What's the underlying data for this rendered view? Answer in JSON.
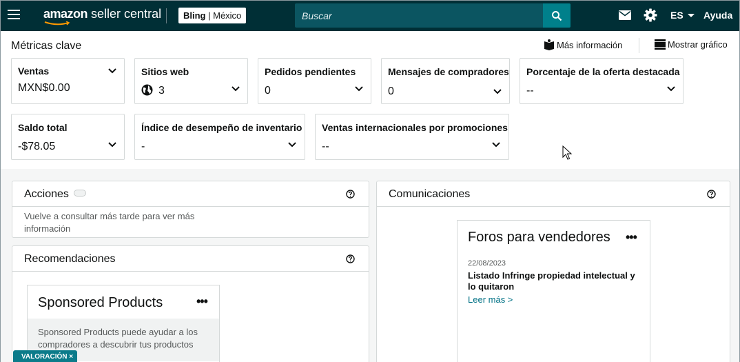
{
  "topnav": {
    "logo_brand": "amazon",
    "logo_rest": " seller central",
    "store_name": "Bling",
    "store_region": "México",
    "search_placeholder": "Buscar",
    "language": "ES",
    "help_label": "Ayuda",
    "bg_color": "#002f36",
    "search_bg": "#0b5561",
    "icons": [
      "menu-icon",
      "search-icon",
      "mail-icon",
      "gear-icon"
    ]
  },
  "metrics": {
    "title": "Métricas clave",
    "more_info_label": "Más información",
    "show_graph_label": "Mostrar gráfico",
    "cards": [
      {
        "label": "Ventas",
        "value": "MXN$0.00"
      },
      {
        "label": "Sitios web",
        "value": "3",
        "icon": "globe-icon"
      },
      {
        "label": "Pedidos pendientes",
        "value": "0"
      },
      {
        "label": "Mensajes de compradores",
        "value": "0"
      },
      {
        "label": "Porcentaje de la oferta destacada",
        "value": "--"
      },
      {
        "label": "Saldo total",
        "value": "-$78.05"
      },
      {
        "label": "Índice de desempeño de inventario",
        "value": "-"
      },
      {
        "label": "Ventas internacionales por promociones",
        "value": "--"
      }
    ]
  },
  "acciones": {
    "title": "Acciones",
    "message": "Vuelve a consultar más tarde para ver más información"
  },
  "recomendaciones": {
    "title": "Recomendaciones",
    "card_title": "Sponsored Products",
    "card_desc": "Sponsored Products puede ayudar a los compradores a descubrir tus productos"
  },
  "comunicaciones": {
    "title": "Comunicaciones",
    "card_title": "Foros para vendedores",
    "date": "22/08/2023",
    "post_title": "Listado Infringe propiedad intelectual y lo quitaron",
    "read_more": "Leer más >"
  },
  "feedback_tag": {
    "label": "VALORACIÓN",
    "close": "×",
    "color": "#0b7b8a"
  }
}
